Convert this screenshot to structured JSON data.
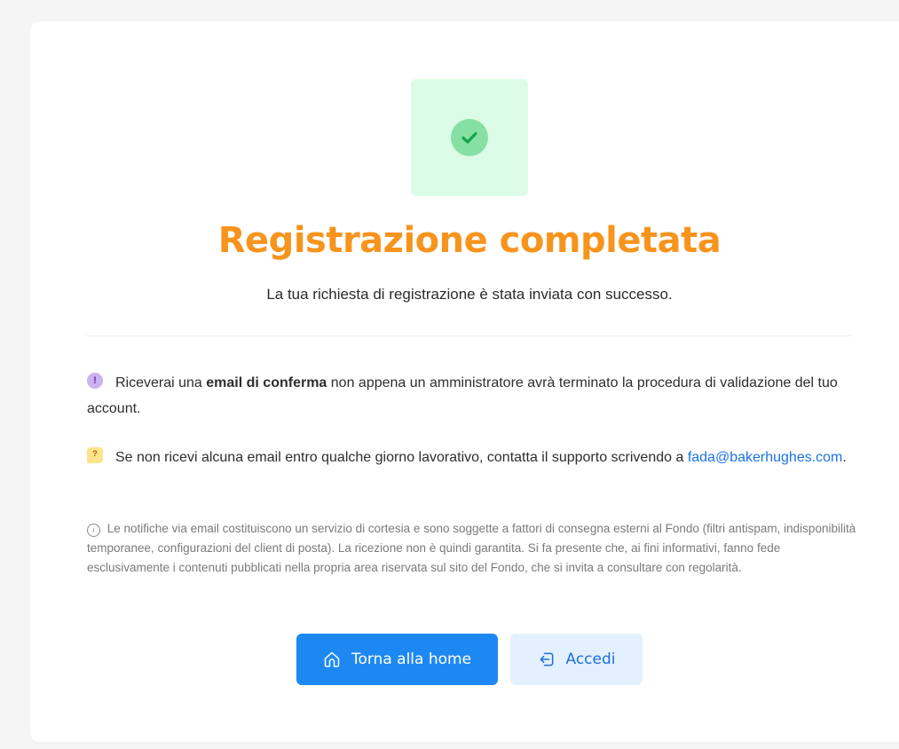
{
  "status": {
    "icon": "check-circle-icon",
    "tile_color": "#dcfce7",
    "check_color": "#22c55e"
  },
  "title": "Registrazione completata",
  "subtitle": "La tua richiesta di registrazione è stata inviata con successo.",
  "notice_confirm": {
    "icon": "exclamation-icon",
    "prefix": "Riceverai una ",
    "bold": "email di conferma",
    "suffix": " non appena un amministratore avrà terminato la procedura di validazione del tuo account."
  },
  "notice_support": {
    "icon": "question-bubble-icon",
    "text": "Se non ricevi alcuna email entro qualche giorno lavorativo, contatta il supporto scrivendo a ",
    "email": "fada@bakerhughes.com",
    "after": "."
  },
  "disclaimer": {
    "icon": "info-icon",
    "text": "Le notifiche via email costituiscono un servizio di cortesia e sono soggette a fattori di consegna esterni al Fondo (filtri antispam, indisponibilità temporanee, configurazioni del client di posta). La ricezione non è quindi garantita. Si fa presente che, ai fini informativi, fanno fede esclusivamente i contenuti pubblicati nella propria area riservata sul sito del Fondo, che si invita a consultare con regolarità."
  },
  "buttons": {
    "home": {
      "label": "Torna alla home",
      "icon": "home-icon"
    },
    "login": {
      "label": "Accedi",
      "icon": "login-icon"
    }
  },
  "colors": {
    "accent": "#f7941d",
    "primary": "#1e88f2",
    "link": "#1a73e8"
  }
}
